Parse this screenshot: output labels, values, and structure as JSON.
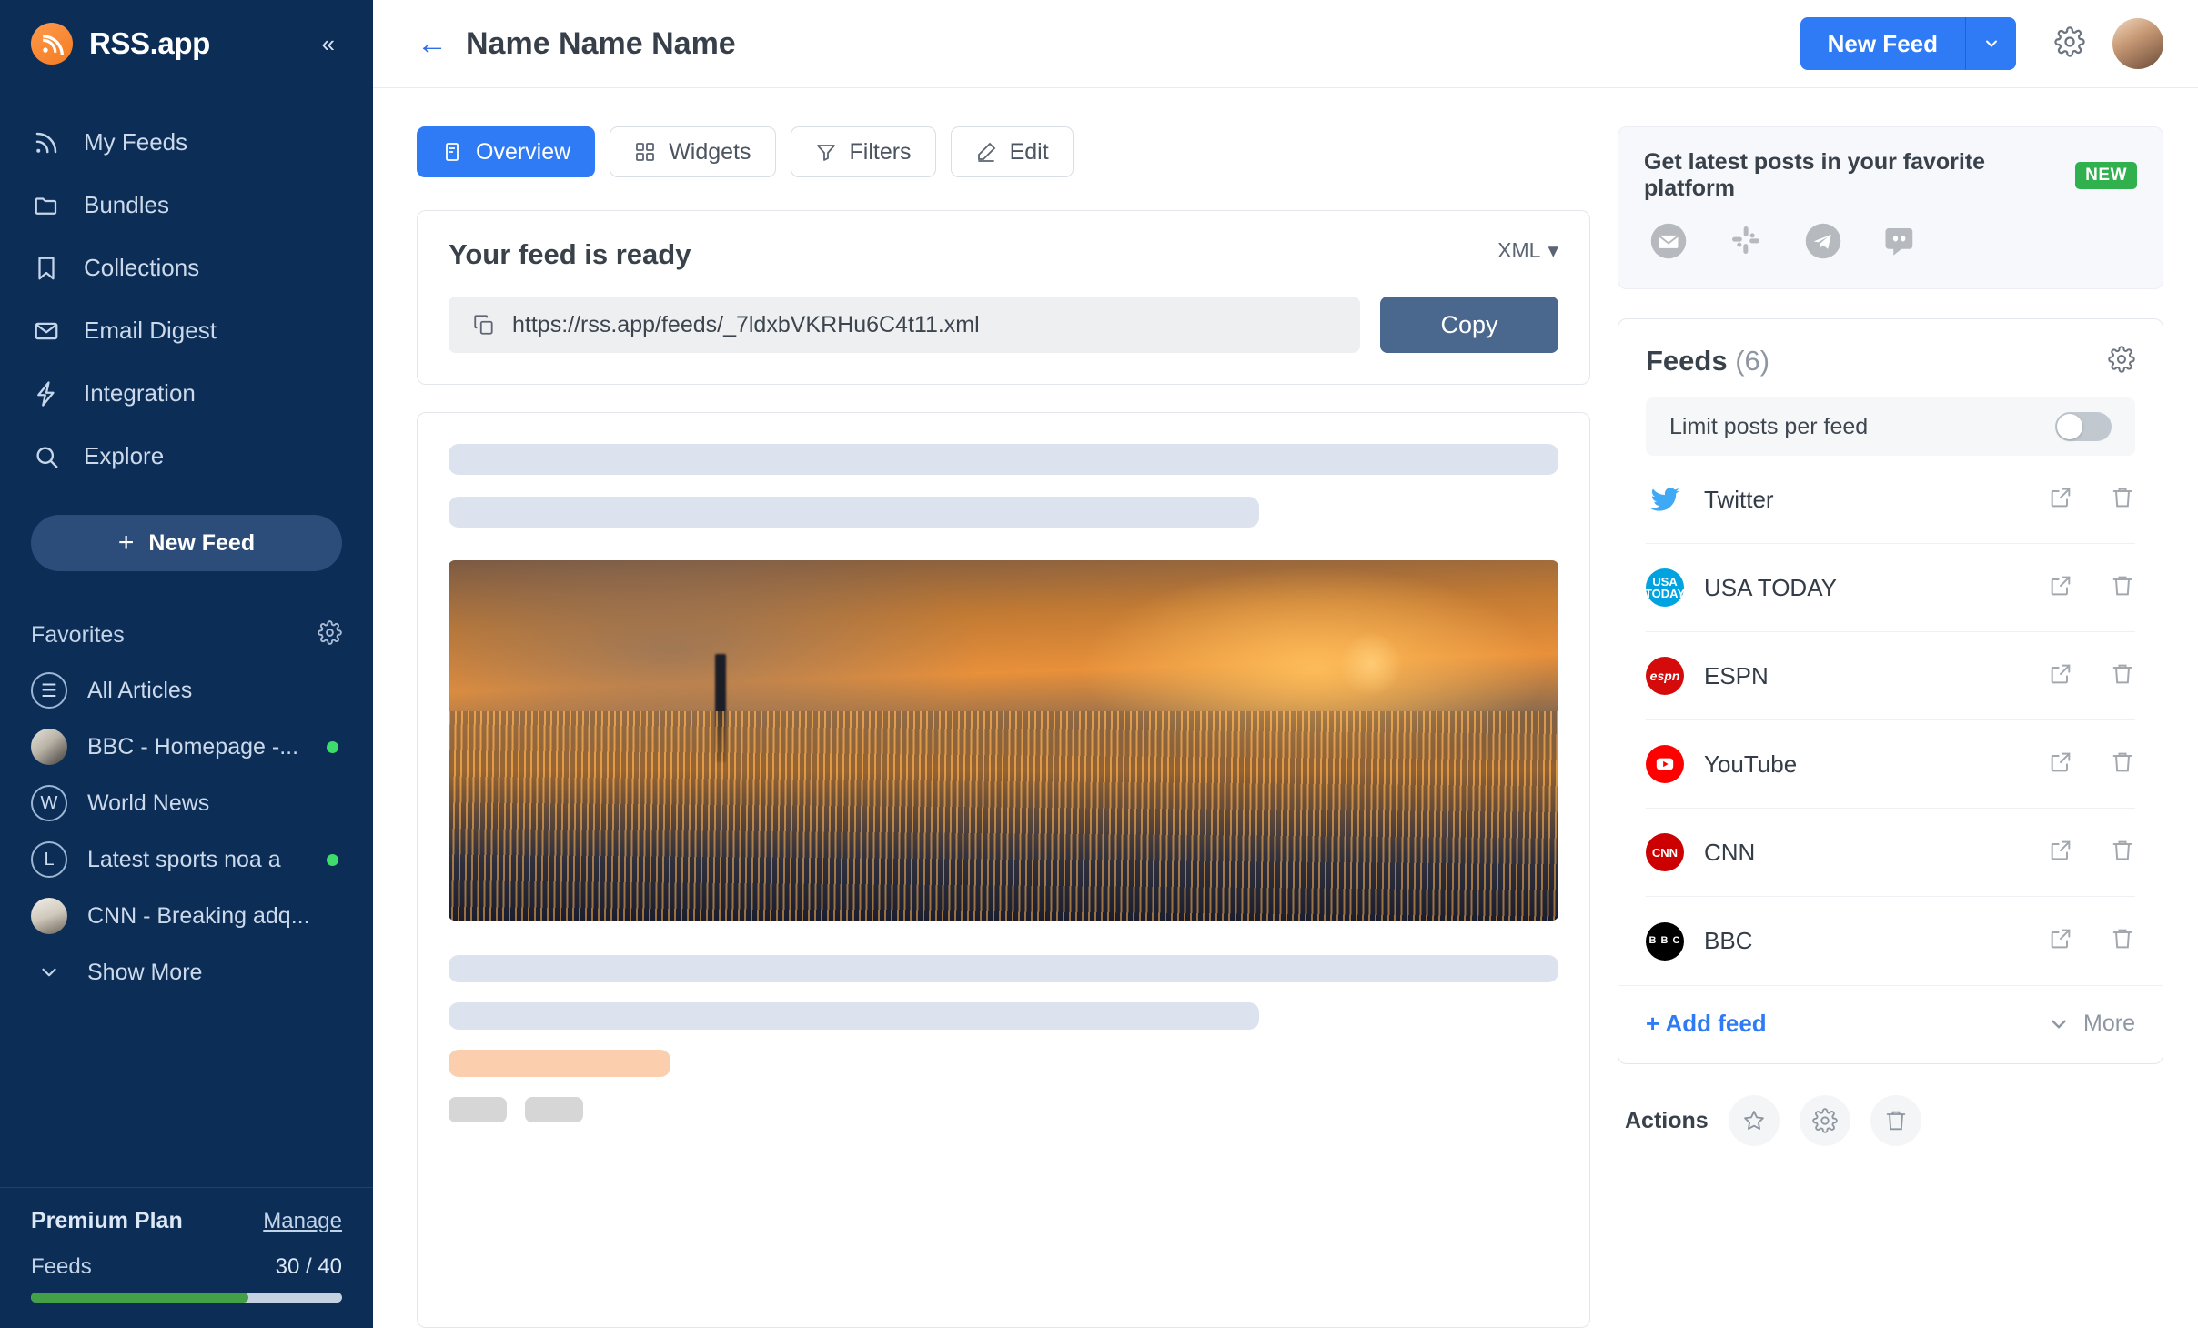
{
  "sidebar": {
    "brand": "RSS.app",
    "collapse_icon": "chevrons-left-icon",
    "nav": [
      {
        "label": "My Feeds",
        "icon": "rss-icon"
      },
      {
        "label": "Bundles",
        "icon": "folder-icon"
      },
      {
        "label": "Collections",
        "icon": "bookmark-icon"
      },
      {
        "label": "Email Digest",
        "icon": "envelope-icon"
      },
      {
        "label": "Integration",
        "icon": "bolt-icon"
      },
      {
        "label": "Explore",
        "icon": "search-icon"
      }
    ],
    "new_feed_button": "New Feed",
    "favorites_title": "Favorites",
    "favorites": [
      {
        "label": "All Articles",
        "avatar": "all-articles",
        "initial": "☰",
        "dot": false
      },
      {
        "label": "BBC - Homepage -...",
        "avatar": "photo-bbc",
        "initial": "",
        "dot": true
      },
      {
        "label": "World News",
        "avatar": "ring",
        "initial": "W",
        "dot": false
      },
      {
        "label": "Latest sports noa a",
        "avatar": "ring",
        "initial": "L",
        "dot": true
      },
      {
        "label": "CNN - Breaking adq...",
        "avatar": "photo-cnn",
        "initial": "",
        "dot": false
      }
    ],
    "show_more": "Show More",
    "plan": {
      "name": "Premium Plan",
      "manage": "Manage",
      "feeds_label": "Feeds",
      "feeds_value": "30 / 40",
      "progress_percent": 70,
      "progress_color": "#43a047"
    }
  },
  "header": {
    "back_icon": "arrow-left-icon",
    "title": "Name Name Name",
    "new_feed_button": "New Feed",
    "new_feed_caret": "chevron-down-icon",
    "settings_icon": "gear-icon",
    "avatar": "user-avatar"
  },
  "tabs": [
    {
      "label": "Overview",
      "icon": "overview-icon",
      "active": true
    },
    {
      "label": "Widgets",
      "icon": "widgets-icon",
      "active": false
    },
    {
      "label": "Filters",
      "icon": "filter-icon",
      "active": false
    },
    {
      "label": "Edit",
      "icon": "pencil-icon",
      "active": false
    }
  ],
  "feed_ready": {
    "title": "Your feed is ready",
    "format": "XML",
    "format_caret": "caret-down-icon",
    "url": "https://rss.app/feeds/_7ldxbVKRHu6C4t11.xml",
    "copy_button": "Copy"
  },
  "platform": {
    "title": "Get latest posts in your favorite platform",
    "badge": "NEW",
    "badge_color": "#30b14e",
    "icons": [
      "email-icon",
      "slack-icon",
      "telegram-icon",
      "discord-icon"
    ]
  },
  "feeds_panel": {
    "title": "Feeds",
    "count": "(6)",
    "settings_icon": "gear-icon",
    "limit_label": "Limit posts per feed",
    "limit_enabled": false,
    "rows": [
      {
        "name": "Twitter",
        "icon": "twitter-icon",
        "color": "#3fa9f5"
      },
      {
        "name": "USA TODAY",
        "icon": "usatoday-icon",
        "color": "#00a3e0"
      },
      {
        "name": "ESPN",
        "icon": "espn-icon",
        "color": "#d50a0a"
      },
      {
        "name": "YouTube",
        "icon": "youtube-icon",
        "color": "#ff0000"
      },
      {
        "name": "CNN",
        "icon": "cnn-icon",
        "color": "#cc0000"
      },
      {
        "name": "BBC",
        "icon": "bbc-icon",
        "color": "#000000"
      }
    ],
    "row_actions": [
      "open-external-icon",
      "delete-icon"
    ],
    "add_feed": "+ Add feed",
    "more": "More",
    "more_caret": "chevron-down-icon"
  },
  "actions": {
    "label": "Actions",
    "buttons": [
      "star-icon",
      "gear-icon",
      "trash-icon"
    ]
  }
}
